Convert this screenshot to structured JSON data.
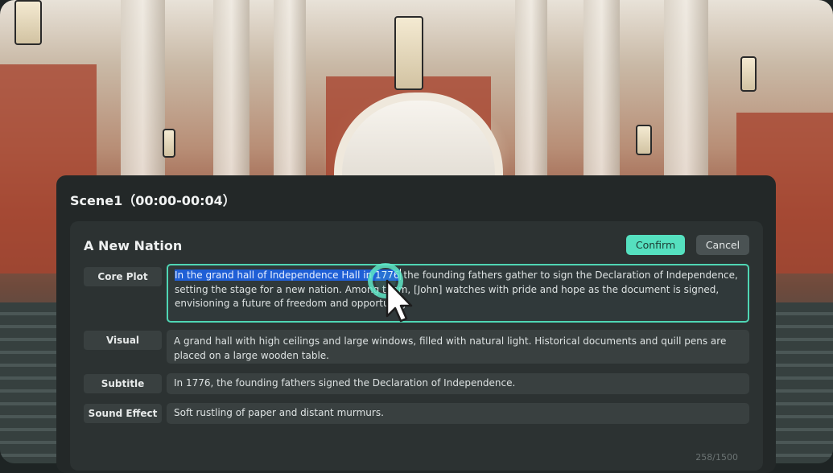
{
  "scene": {
    "title": "Scene1（00:00-00:04）"
  },
  "card": {
    "title": "A New Nation",
    "confirm_label": "Confirm",
    "cancel_label": "Cancel",
    "counter": "258/1500"
  },
  "rows": [
    {
      "label": "Core Plot",
      "selected_text": "In the grand hall of Independence Hall in 1776",
      "rest_text": " the founding fathers gather to sign the Declaration of Independence, setting the stage for a new nation. Among them, [John] watches with pride and hope as the document is signed, envisioning a future of freedom and opportunity."
    },
    {
      "label": "Visual",
      "text": "A grand hall with high ceilings and large windows, filled with natural light. Historical documents and quill pens are placed on a large wooden table."
    },
    {
      "label": "Subtitle",
      "text": "In 1776, the founding fathers signed the Declaration of Independence."
    },
    {
      "label": "Sound Effect",
      "text": "Soft rustling of paper and distant murmurs."
    }
  ],
  "colors": {
    "accent": "#55e0bf",
    "selection": "#1f5fd6",
    "panel": "#232828"
  },
  "icons": {
    "pointer": "mouse-pointer-icon"
  }
}
